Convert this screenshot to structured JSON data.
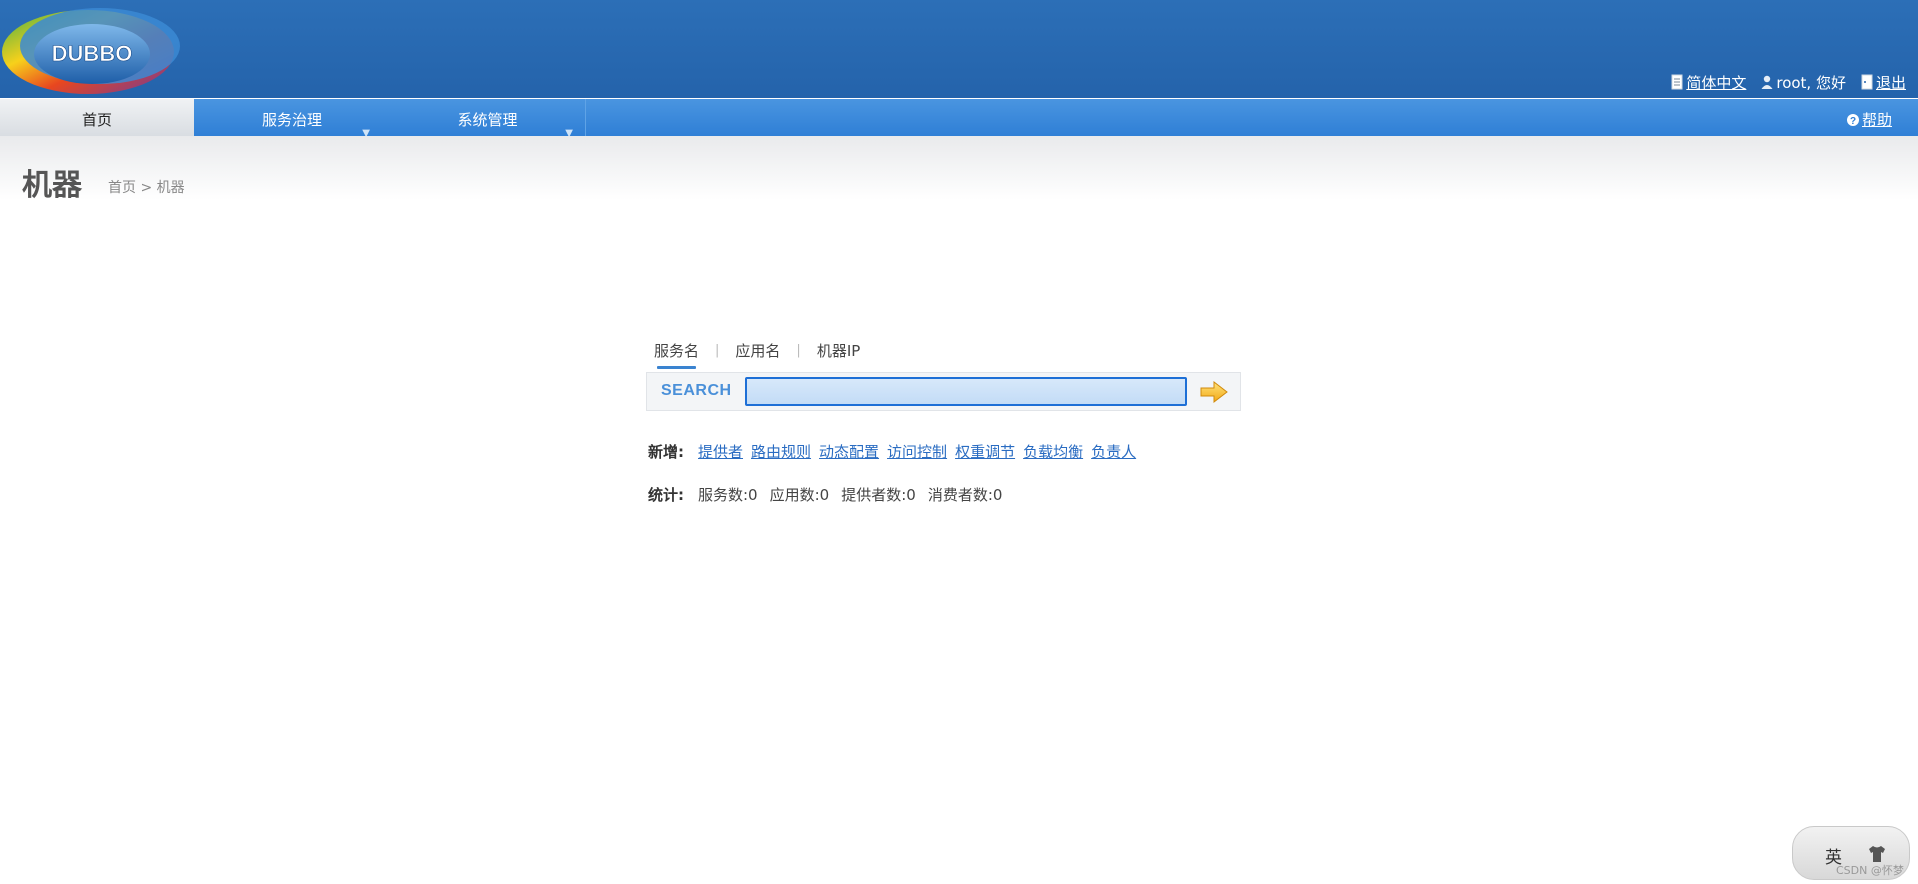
{
  "header": {
    "logo_text": "DUBBO",
    "language_link": "简体中文",
    "greeting": "root, 您好",
    "logout_link": "退出"
  },
  "nav": {
    "home": "首页",
    "service_governance": "服务治理",
    "system_admin": "系统管理",
    "help": "帮助"
  },
  "page": {
    "title": "机器",
    "breadcrumb": "首页 > 机器"
  },
  "search": {
    "tabs": [
      "服务名",
      "应用名",
      "机器IP"
    ],
    "active_tab": 0,
    "label": "SEARCH",
    "value": ""
  },
  "add": {
    "label": "新增:",
    "links": [
      "提供者",
      "路由规则",
      "动态配置",
      "访问控制",
      "权重调节",
      "负载均衡",
      "负责人"
    ]
  },
  "stats": {
    "label": "统计:",
    "items": [
      "服务数:0",
      "应用数:0",
      "提供者数:0",
      "消费者数:0"
    ]
  },
  "ime": {
    "char": "英"
  },
  "watermark": "CSDN @怀梦",
  "colors": {
    "header_bg": "#2463ab",
    "nav_bg": "#3a88da",
    "link": "#2a6cc2",
    "search_input_border": "#1d6fd6"
  }
}
